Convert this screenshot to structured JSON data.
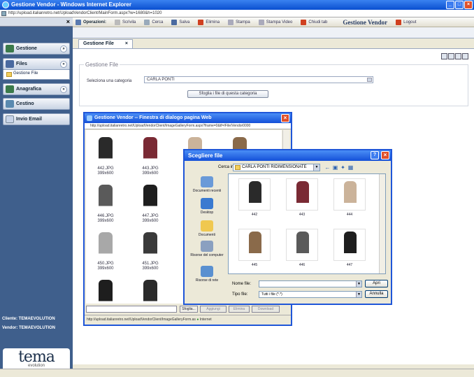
{
  "window": {
    "title": "Gestione Vendor - Windows Internet Explorer",
    "url": "http://upload.italianretro.net/UploadVendorClient/MainForm.aspx?w=1680&h=1020"
  },
  "sidebar": {
    "items": [
      {
        "label": "Gestione",
        "icon": "person-icon"
      },
      {
        "label": "Files",
        "icon": "folder-icon"
      },
      {
        "label": "Anagrafica",
        "icon": "person-icon"
      },
      {
        "label": "Cestino",
        "icon": "trash-icon"
      },
      {
        "label": "Invio Email",
        "icon": "mail-icon"
      }
    ],
    "subitem": "Gestione File",
    "cliente": "Cliente: TEMAEVOLUTION",
    "vendor": "Vendor: TEMAEVOLUTION",
    "logo_main": "tema",
    "logo_sub": "evolution"
  },
  "toolbar": {
    "heading": "Operazioni:",
    "items": [
      "Scrivila",
      "Cerca",
      "Salva",
      "Elimina",
      "Stampa",
      "Stampa Video",
      "Chiudi tab"
    ],
    "brand": "Gestione Vendor",
    "logout": "Logout"
  },
  "tab": {
    "label": "Gestione File"
  },
  "form": {
    "legend": "Gestione File",
    "category_label": "Seleziona una categoria",
    "category_value": "CARLA PONTI",
    "browse_button": "Sfoglia i file di questa categoria"
  },
  "web_dialog": {
    "title": "Gestione Vendor -- Finestra di dialogo pagina Web",
    "url": "http://upload.italianretro.net/UploadVendorClient/ImageGalleryForm.aspx?frame=0&tf=/File/Vendor0000",
    "images": [
      {
        "name": "442.JPG",
        "size": "399x600",
        "color": "#2a2a2a"
      },
      {
        "name": "443.JPG",
        "size": "399x600",
        "color": "#7a2a34"
      },
      {
        "name": "",
        "size": "",
        "color": "#cbb39a"
      },
      {
        "name": "",
        "size": "",
        "color": "#8a6a4a"
      },
      {
        "name": "446.JPG",
        "size": "399x600",
        "color": "#5a5a5a"
      },
      {
        "name": "447.JPG",
        "size": "399x600",
        "color": "#1e1e1e"
      },
      {
        "name": "450.JPG",
        "size": "399x600",
        "color": "#a8a8a8"
      },
      {
        "name": "451.JPG",
        "size": "399x600",
        "color": "#3a3a3a"
      },
      {
        "name": "",
        "size": "",
        "color": "#1e1e1e"
      },
      {
        "name": "",
        "size": "",
        "color": "#2a2a2a"
      }
    ],
    "browse": "Sfoglia...",
    "add": "Aggiungi",
    "remove": "Elimina",
    "download": "Download",
    "status": "http://upload.italianretro.net/UploadVendorClient/ImageGalleryForm.as",
    "zone": "Internet"
  },
  "file_dialog": {
    "title": "Scegliere file",
    "look_in_label": "Cerca in:",
    "look_in_value": "CARLA PONTI RIDIMENSIONATE",
    "places": [
      "Documenti recenti",
      "Desktop",
      "Documenti",
      "Risorse del computer",
      "Risorse di rete"
    ],
    "files": [
      {
        "name": "442",
        "color": "#2a2a2a"
      },
      {
        "name": "443",
        "color": "#7a2a34"
      },
      {
        "name": "444",
        "color": "#cbb39a"
      },
      {
        "name": "445",
        "color": "#8a6a4a"
      },
      {
        "name": "446",
        "color": "#5a5a5a"
      },
      {
        "name": "447",
        "color": "#1e1e1e"
      }
    ],
    "filename_label": "Nome file:",
    "filename_value": "",
    "filetype_label": "Tipo file:",
    "filetype_value": "Tutti i file (*.*)",
    "open": "Apri",
    "cancel": "Annulla"
  }
}
